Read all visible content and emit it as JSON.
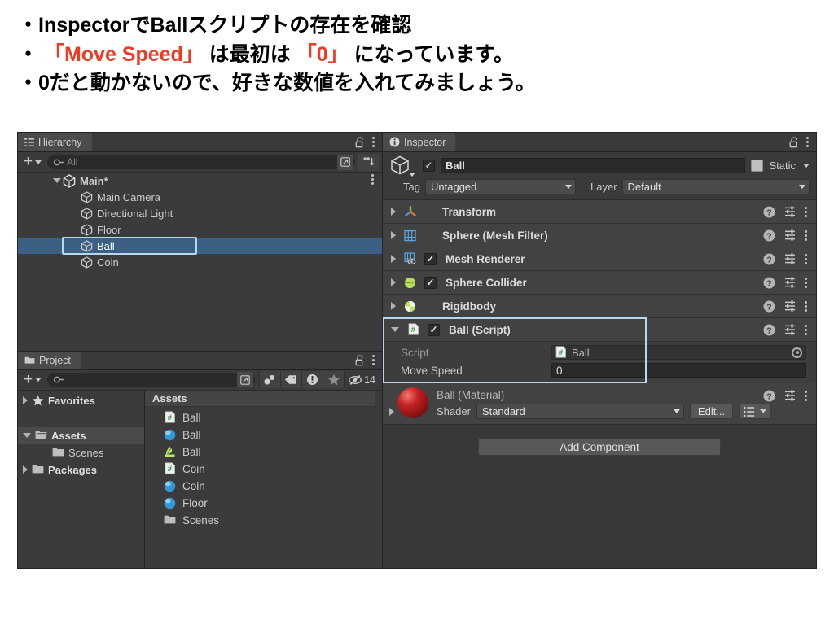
{
  "slide": {
    "lines": [
      {
        "segments": [
          {
            "t": "・InspectorでBallスクリプトの存在を確認",
            "c": "black"
          }
        ]
      },
      {
        "segments": [
          {
            "t": "・ ",
            "c": "black"
          },
          {
            "t": "「Move Speed」",
            "c": "red"
          },
          {
            "t": " は最初は ",
            "c": "black"
          },
          {
            "t": "「0」",
            "c": "red"
          },
          {
            "t": " になっています。",
            "c": "black"
          }
        ]
      },
      {
        "segments": [
          {
            "t": "・0だと動かないので、好きな数値を入れてみましょう。",
            "c": "black"
          }
        ]
      }
    ],
    "accent_color": "#ee3b24"
  },
  "hierarchy": {
    "tab_label": "Hierarchy",
    "lock_icon": "lock-open-icon",
    "menu_icon": "kebab-menu-icon",
    "create_label": "+",
    "search_placeholder": "All",
    "search_icon": "search-icon",
    "tool_icons": [
      "open-in-new-icon",
      "sort-icon"
    ],
    "items": [
      {
        "label": "Main*",
        "depth": 0,
        "icon": "unity-scene-icon",
        "foldout": "open",
        "selected": false,
        "bold": true
      },
      {
        "label": "Main Camera",
        "depth": 1,
        "icon": "gameobject-cube-icon",
        "foldout": "none",
        "selected": false,
        "bold": false
      },
      {
        "label": "Directional Light",
        "depth": 1,
        "icon": "gameobject-cube-icon",
        "foldout": "none",
        "selected": false,
        "bold": false
      },
      {
        "label": "Floor",
        "depth": 1,
        "icon": "gameobject-cube-icon",
        "foldout": "none",
        "selected": false,
        "bold": false
      },
      {
        "label": "Ball",
        "depth": 1,
        "icon": "gameobject-cube-icon",
        "foldout": "none",
        "selected": true,
        "bold": false
      },
      {
        "label": "Coin",
        "depth": 1,
        "icon": "gameobject-cube-icon",
        "foldout": "none",
        "selected": false,
        "bold": false
      }
    ]
  },
  "project": {
    "tab_label": "Project",
    "lock_icon": "lock-open-icon",
    "menu_icon": "kebab-menu-icon",
    "create_label": "+",
    "search_placeholder": "",
    "search_icon": "search-icon",
    "filter_icons": [
      "asset-type-filter-icon",
      "label-filter-icon",
      "warning-filter-icon",
      "favorite-star-icon"
    ],
    "hidden_count": "14",
    "hidden_icon": "eye-slash-icon",
    "tree": [
      {
        "label": "Favorites",
        "icon": "star-icon",
        "depth": 0,
        "foldout": "closed",
        "selected": false,
        "bold": true
      },
      {
        "label": "Assets",
        "icon": "folder-open-icon",
        "depth": 0,
        "foldout": "open",
        "selected": true,
        "bold": true
      },
      {
        "label": "Scenes",
        "icon": "folder-icon",
        "depth": 1,
        "foldout": "none",
        "selected": false,
        "bold": false
      },
      {
        "label": "Packages",
        "icon": "folder-icon",
        "depth": 0,
        "foldout": "closed",
        "selected": false,
        "bold": true
      }
    ],
    "breadcrumb": "Assets",
    "assets": [
      {
        "label": "Ball",
        "icon": "csharp-script-icon"
      },
      {
        "label": "Ball",
        "icon": "material-sphere-icon"
      },
      {
        "label": "Ball",
        "icon": "prefab-icon"
      },
      {
        "label": "Coin",
        "icon": "csharp-script-icon"
      },
      {
        "label": "Coin",
        "icon": "material-sphere-icon"
      },
      {
        "label": "Floor",
        "icon": "material-sphere-icon"
      },
      {
        "label": "Scenes",
        "icon": "folder-icon"
      }
    ]
  },
  "inspector": {
    "tab_label": "Inspector",
    "tab_icon": "info-icon",
    "lock_icon": "lock-open-icon",
    "menu_icon": "kebab-menu-icon",
    "gameobject": {
      "icon": "gameobject-cube-icon",
      "enabled": true,
      "name": "Ball",
      "static_checked": false,
      "static_label": "Static",
      "tag_label": "Tag",
      "tag_value": "Untagged",
      "layer_label": "Layer",
      "layer_value": "Default"
    },
    "components": [
      {
        "name": "Transform",
        "icon": "transform-axis-icon",
        "foldout": "closed",
        "has_toggle": false,
        "toggle_checked": false
      },
      {
        "name": "Sphere (Mesh Filter)",
        "icon": "mesh-filter-grid-icon",
        "foldout": "closed",
        "has_toggle": false,
        "toggle_checked": false
      },
      {
        "name": "Mesh Renderer",
        "icon": "mesh-renderer-icon",
        "foldout": "closed",
        "has_toggle": true,
        "toggle_checked": true
      },
      {
        "name": "Sphere Collider",
        "icon": "sphere-collider-icon",
        "foldout": "closed",
        "has_toggle": true,
        "toggle_checked": true
      },
      {
        "name": "Rigidbody",
        "icon": "rigidbody-icon",
        "foldout": "closed",
        "has_toggle": false,
        "toggle_checked": false
      }
    ],
    "script_component": {
      "name": "Ball (Script)",
      "icon": "csharp-script-icon",
      "foldout": "open",
      "toggle_checked": true,
      "highlighted": true,
      "highlight_color": "#b9d7ea",
      "properties": [
        {
          "label": "Script",
          "type": "object",
          "value": "Ball",
          "icon": "csharp-script-icon",
          "readonly": true
        },
        {
          "label": "Move Speed",
          "type": "number",
          "value": "0",
          "readonly": false
        }
      ]
    },
    "material": {
      "title": "Ball (Material)",
      "thumb_icon": "material-sphere-preview",
      "thumb_color": "#c42424",
      "shader_label": "Shader",
      "shader_value": "Standard",
      "edit_label": "Edit...",
      "preset_icon": "preset-list-icon",
      "foldout": "closed"
    },
    "add_component_label": "Add Component",
    "row_icons": {
      "help": "help-icon",
      "preset": "preset-settings-icon",
      "menu": "kebab-menu-icon"
    }
  }
}
